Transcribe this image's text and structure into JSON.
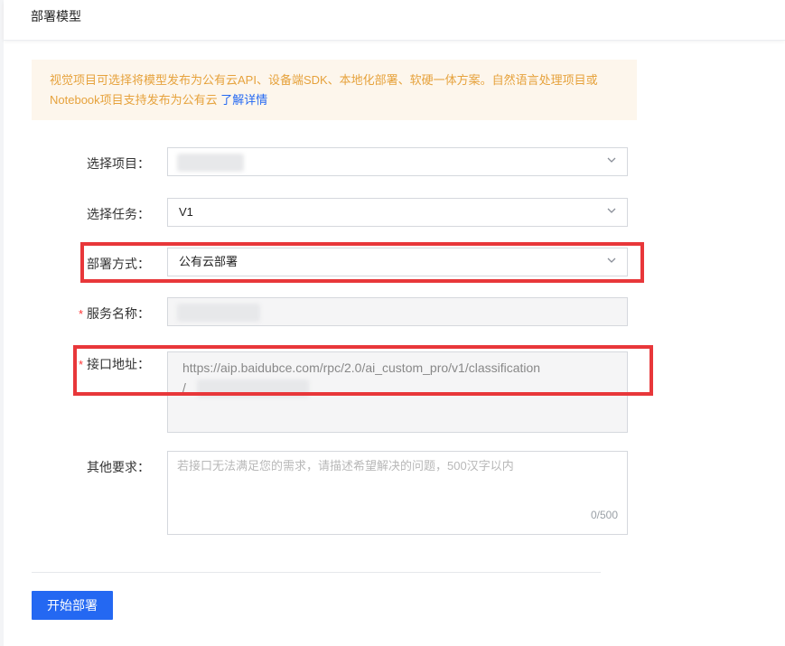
{
  "header": {
    "title": "部署模型"
  },
  "notice": {
    "text": "视觉项目可选择将模型发布为公有云API、设备端SDK、本地化部署、软硬一体方案。自然语言处理项目或Notebook项目支持发布为公有云",
    "link": "了解详情"
  },
  "form": {
    "project": {
      "label": "选择项目：",
      "value": ""
    },
    "task": {
      "label": "选择任务：",
      "value": "V1"
    },
    "deploy_method": {
      "label": "部署方式：",
      "value": "公有云部署"
    },
    "service_name": {
      "label": "服务名称：",
      "required_mark": "*"
    },
    "api_address": {
      "label": "接口地址：",
      "required_mark": "*",
      "value": "https://aip.baidubce.com/rpc/2.0/ai_custom_pro/v1/classification",
      "suffix": "/"
    },
    "other_requirements": {
      "label": "其他要求：",
      "placeholder": "若接口无法满足您的需求，请描述希望解决的问题，500汉字以内",
      "counter": "0/500"
    }
  },
  "actions": {
    "submit_label": "开始部署"
  },
  "colors": {
    "accent": "#2468f2",
    "highlight": "#e8373a",
    "notice_text": "#e6a23c"
  }
}
